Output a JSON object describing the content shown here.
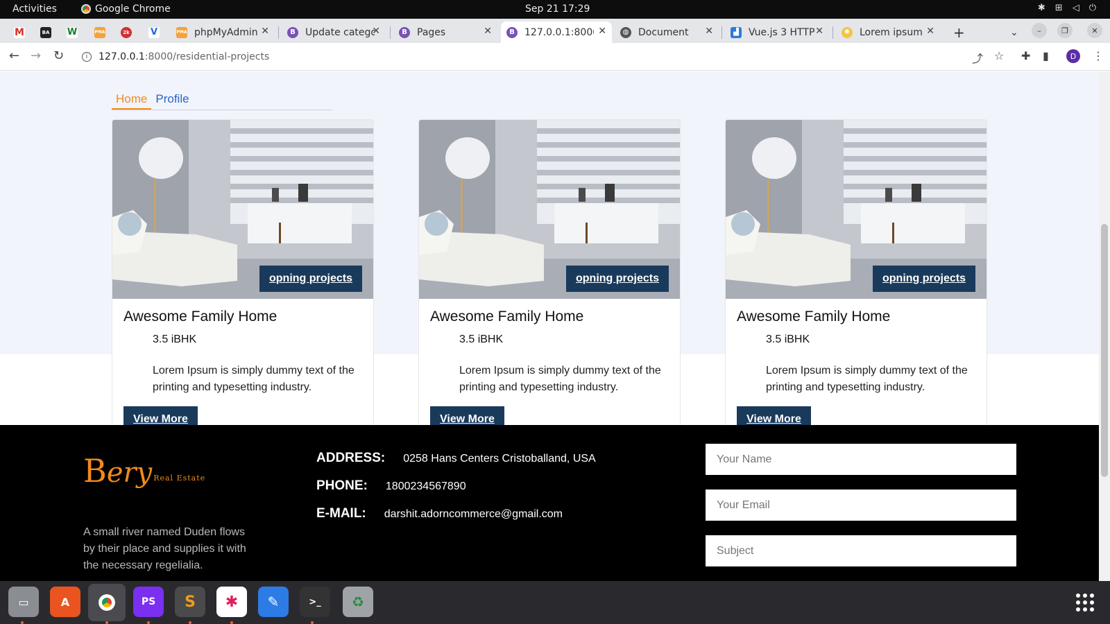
{
  "system": {
    "activities": "Activities",
    "app_name": "Google Chrome",
    "clock": "Sep 21  17:29"
  },
  "tabs": [
    {
      "label": "",
      "favicon": "gmail-icon"
    },
    {
      "label": "",
      "favicon": "ba-icon"
    },
    {
      "label": "",
      "favicon": "w-icon"
    },
    {
      "label": "",
      "favicon": "pma-icon"
    },
    {
      "label": "",
      "favicon": "2k-icon"
    },
    {
      "label": "",
      "favicon": "v-icon"
    },
    {
      "label": "phpMyAdmin",
      "favicon": "phpmyadmin-icon"
    },
    {
      "label": "Update catego",
      "favicon": "bootstrap-icon"
    },
    {
      "label": "Pages",
      "favicon": "bootstrap-icon"
    },
    {
      "label": "127.0.0.1:8000",
      "favicon": "bootstrap-icon",
      "active": true
    },
    {
      "label": "Document",
      "favicon": "globe-icon"
    },
    {
      "label": "Vue.js 3 HTTP",
      "favicon": "chart-icon"
    },
    {
      "label": "Lorem ipsum",
      "favicon": "sun-icon"
    }
  ],
  "address": {
    "host": "127.0.0.1",
    "path": ":8000/residential-projects"
  },
  "profile_initial": "D",
  "page": {
    "nav": {
      "home": "Home",
      "profile": "Profile"
    },
    "cards": [
      {
        "badge": "opning projects",
        "title": "Awesome Family Home",
        "bhk": "3.5 iBHK",
        "desc": "Lorem Ipsum is simply dummy text of the printing and typesetting industry.",
        "button": "View More"
      },
      {
        "badge": "opning projects",
        "title": "Awesome Family Home",
        "bhk": "3.5 iBHK",
        "desc": "Lorem Ipsum is simply dummy text of the printing and typesetting industry.",
        "button": "View More"
      },
      {
        "badge": "opning projects",
        "title": "Awesome Family Home",
        "bhk": "3.5 iBHK",
        "desc": "Lorem Ipsum is simply dummy text of the printing and typesetting industry.",
        "button": "View More"
      }
    ],
    "footer": {
      "logo_letter": "B",
      "logo_text": "ery",
      "logo_sub": "Real Estate",
      "about": "A small river named Duden flows by their place and supplies it with the necessary regelialia.",
      "address_label": "ADDRESS:",
      "address": "0258 Hans Centers Cristoballand, USA",
      "phone_label": "PHONE:",
      "phone": "1800234567890",
      "email_label": "E-MAIL:",
      "email": "darshit.adorncommerce@gmail.com",
      "form": {
        "name_placeholder": "Your Name",
        "email_placeholder": "Your Email",
        "subject_placeholder": "Subject"
      }
    }
  },
  "colors": {
    "accent": "#f08a1c",
    "button": "#1a3a5c",
    "link": "#2a66c8"
  },
  "dock": [
    "files-icon",
    "app-store-icon",
    "chrome-icon",
    "phpstorm-icon",
    "sublime-icon",
    "slack-icon",
    "text-editor-icon",
    "terminal-icon",
    "trash-icon"
  ]
}
